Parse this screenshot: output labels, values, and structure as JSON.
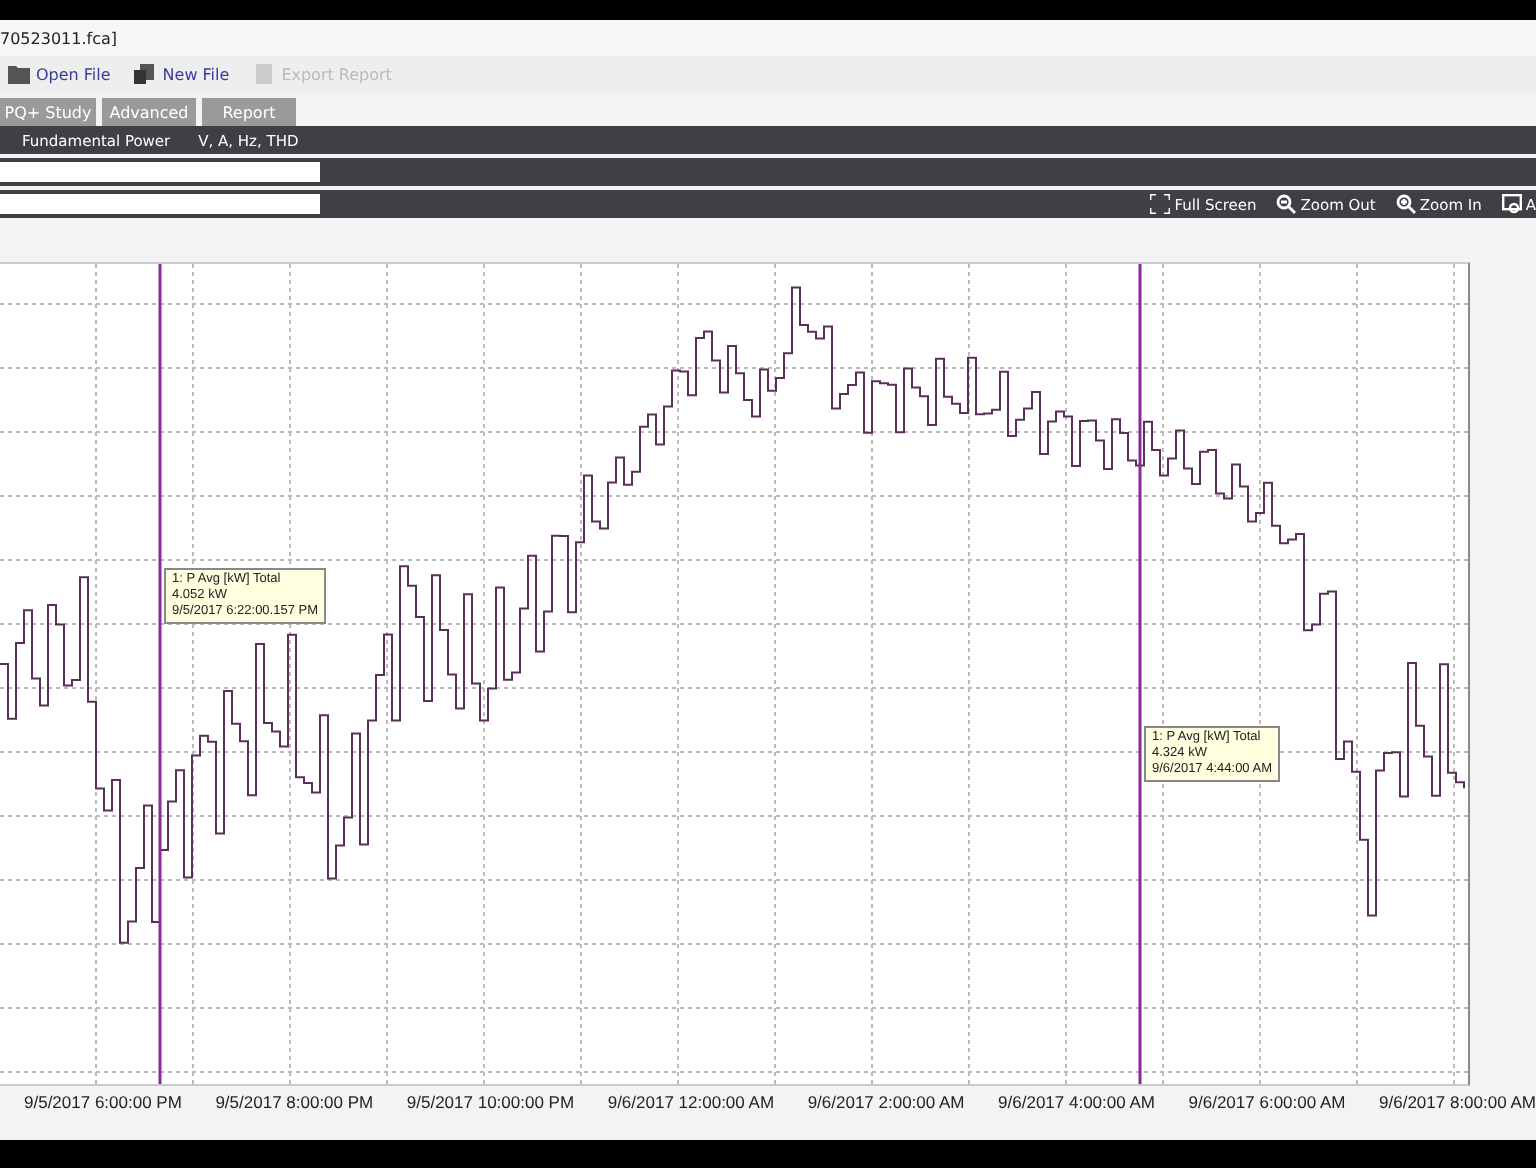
{
  "window": {
    "title": "70523011.fca]"
  },
  "toolbar": [
    {
      "label": "Open File",
      "kind": "folder",
      "disabled": false
    },
    {
      "label": "New File",
      "kind": "document",
      "disabled": false
    },
    {
      "label": "Export Report",
      "kind": "report",
      "disabled": true
    }
  ],
  "tabs": [
    {
      "label": "PQ+ Study",
      "selected": false
    },
    {
      "label": "Advanced",
      "selected": false
    },
    {
      "label": "Report",
      "selected": false
    }
  ],
  "subtabs": [
    {
      "label": "Fundamental Power"
    },
    {
      "label": "V, A, Hz, THD"
    }
  ],
  "view_buttons": [
    {
      "label": "Full Screen",
      "kind": "fullscreen"
    },
    {
      "label": "Zoom Out",
      "kind": "zoom-out"
    },
    {
      "label": "Zoom In",
      "kind": "zoom-in"
    },
    {
      "label": "A",
      "kind": "window"
    }
  ],
  "cursors": [
    {
      "lines": [
        "1: P Avg [kW] Total",
        "4.052 kW",
        "9/5/2017 6:22:00.157 PM"
      ]
    },
    {
      "lines": [
        "1: P Avg [kW] Total",
        "4.324 kW",
        "9/6/2017 4:44:00 AM"
      ]
    }
  ],
  "x_labels": [
    "9/5/2017 6:00:00 PM",
    "9/5/2017 8:00:00 PM",
    "9/5/2017 10:00:00 PM",
    "9/6/2017 12:00:00 AM",
    "9/6/2017 2:00:00 AM",
    "9/6/2017 4:00:00 AM",
    "9/6/2017 6:00:00 AM",
    "9/6/2017 8:00:00 AM"
  ]
}
